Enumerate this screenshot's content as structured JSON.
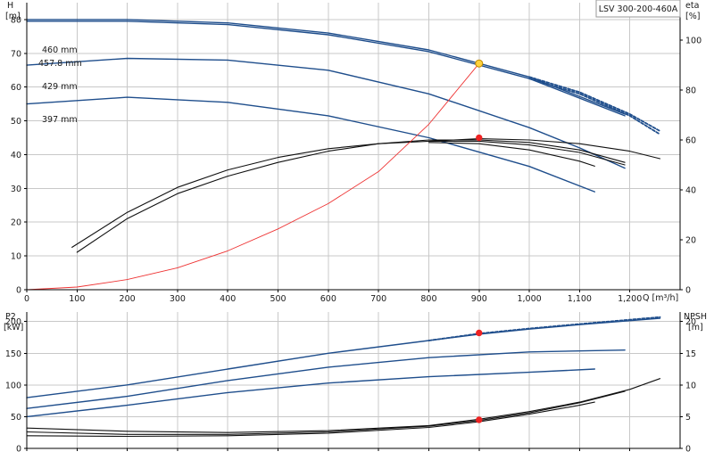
{
  "title": "LSV 300-200-460A",
  "colors": {
    "head": "#1f4e8c",
    "eff": "#111111",
    "system": "#ee3333",
    "duty": "#ee2222",
    "duty_highlight": "#ffd23c",
    "grid": "#c8c8c8"
  },
  "chart_data": [
    {
      "name": "head-chart",
      "type": "line",
      "title": "LSV 300-200-460A",
      "xlabel": "Q [m³/h]",
      "ylabel_left": "H [m]",
      "ylabel_right": "eta [%]",
      "xlim": [
        0,
        1300
      ],
      "ylim_left": [
        0,
        85
      ],
      "ylim_right": [
        0,
        115
      ],
      "x_ticks": [
        "0",
        "100",
        "200",
        "300",
        "400",
        "500",
        "600",
        "700",
        "800",
        "900",
        "1,000",
        "1,100",
        "1,200"
      ],
      "x_tick_values": [
        0,
        100,
        200,
        300,
        400,
        500,
        600,
        700,
        800,
        900,
        1000,
        1100,
        1200
      ],
      "y_ticks_left": [
        0,
        10,
        20,
        30,
        40,
        50,
        60,
        70,
        80
      ],
      "y_ticks_right": [
        0,
        20,
        40,
        60,
        80,
        100
      ],
      "grid": true,
      "diameter_labels": [
        "460 mm",
        "457.8 mm",
        "429 mm",
        "397 mm"
      ],
      "series": [
        {
          "name": "460 mm",
          "axis": "left",
          "style": "head",
          "x": [
            0,
            200,
            400,
            600,
            800,
            1000,
            1190
          ],
          "y": [
            80,
            80,
            79,
            76,
            71,
            63,
            52
          ]
        },
        {
          "axis": "left",
          "style": "head-dashed",
          "x": [
            1000,
            1100,
            1200,
            1260
          ],
          "y": [
            63,
            58.5,
            52,
            47
          ]
        },
        {
          "name": "457.8 mm",
          "axis": "left",
          "style": "head",
          "x": [
            0,
            200,
            400,
            600,
            800,
            1000,
            1190
          ],
          "y": [
            79.5,
            79.5,
            78.5,
            75.5,
            70.5,
            62.5,
            51.5
          ]
        },
        {
          "axis": "left",
          "style": "head-dashed",
          "x": [
            1000,
            1100,
            1200,
            1260
          ],
          "y": [
            62.5,
            58,
            51.5,
            46
          ]
        },
        {
          "name": "429 mm",
          "axis": "left",
          "style": "head",
          "x": [
            0,
            200,
            400,
            600,
            800,
            900,
            1000,
            1100,
            1190
          ],
          "y": [
            66.5,
            68.5,
            68,
            65,
            58,
            53,
            48,
            42,
            36
          ]
        },
        {
          "name": "397 mm",
          "axis": "left",
          "style": "head",
          "x": [
            0,
            200,
            400,
            600,
            800,
            1000,
            1130
          ],
          "y": [
            55,
            57,
            55.5,
            51.5,
            45,
            36.5,
            29
          ]
        },
        {
          "axis": "right",
          "style": "eff",
          "x": [
            90,
            200,
            300,
            400,
            500,
            600,
            700,
            800,
            900,
            1000,
            1100,
            1190
          ],
          "y": [
            17,
            31,
            41,
            48,
            53,
            56.5,
            58.5,
            60,
            60,
            59,
            56,
            51
          ]
        },
        {
          "axis": "right",
          "style": "eff",
          "x": [
            100,
            200,
            300,
            400,
            500,
            600,
            700,
            800,
            900,
            1000,
            1100,
            1200,
            1260
          ],
          "y": [
            15,
            28.5,
            38.5,
            45.5,
            51,
            55.5,
            58.5,
            59.5,
            60.5,
            60,
            58.5,
            55.5,
            52.5
          ]
        },
        {
          "axis": "right",
          "style": "eff",
          "x": [
            800,
            900,
            1000,
            1100,
            1190
          ],
          "y": [
            59.5,
            59.5,
            58,
            55,
            50
          ]
        },
        {
          "axis": "right",
          "style": "eff",
          "x": [
            800,
            900,
            1000,
            1100,
            1130
          ],
          "y": [
            59,
            58.5,
            56,
            51.5,
            49.5
          ]
        },
        {
          "axis": "left",
          "style": "system",
          "x": [
            0,
            100,
            200,
            300,
            400,
            500,
            600,
            700,
            800,
            900
          ],
          "y": [
            0,
            0.8,
            3,
            6.5,
            11.5,
            18,
            25.5,
            35,
            49,
            67
          ]
        }
      ],
      "duty_points": [
        {
          "x": 900,
          "y": 67,
          "axis": "left",
          "highlight": true
        },
        {
          "x": 900,
          "y": 45,
          "axis": "left"
        }
      ]
    },
    {
      "name": "power-npsh-chart",
      "type": "line",
      "ylabel_left": "P2 [kW]",
      "ylabel_right": "NPSH [m]",
      "xlim": [
        0,
        1300
      ],
      "ylim_left": [
        0,
        215
      ],
      "ylim_right": [
        0,
        21.5
      ],
      "y_ticks_left": [
        0,
        50,
        100,
        150,
        200
      ],
      "y_ticks_right": [
        0,
        5,
        10,
        15,
        20
      ],
      "grid": true,
      "series": [
        {
          "axis": "left",
          "style": "head",
          "x": [
            0,
            200,
            400,
            600,
            800,
            900,
            1000,
            1100,
            1260
          ],
          "y": [
            80,
            100,
            125,
            150,
            170,
            180,
            188,
            195,
            205
          ]
        },
        {
          "axis": "left",
          "style": "head-dashed",
          "x": [
            800,
            900,
            1000,
            1100,
            1260
          ],
          "y": [
            170,
            181,
            189,
            196,
            207
          ]
        },
        {
          "axis": "left",
          "style": "head",
          "x": [
            0,
            200,
            400,
            600,
            800,
            1000,
            1190
          ],
          "y": [
            63,
            82,
            107,
            128,
            143,
            152,
            155
          ]
        },
        {
          "axis": "left",
          "style": "head",
          "x": [
            0,
            200,
            400,
            600,
            800,
            1000,
            1130
          ],
          "y": [
            50,
            68,
            88,
            103,
            113,
            120,
            125
          ]
        },
        {
          "axis": "right",
          "style": "eff",
          "x": [
            0,
            200,
            400,
            600,
            800,
            900,
            1000,
            1100,
            1200,
            1260
          ],
          "y": [
            3.2,
            2.7,
            2.5,
            2.8,
            3.6,
            4.6,
            5.8,
            7.3,
            9.3,
            11
          ]
        },
        {
          "axis": "right",
          "style": "eff",
          "x": [
            0,
            200,
            400,
            600,
            800,
            900,
            1000,
            1100,
            1190
          ],
          "y": [
            2.6,
            2.2,
            2.2,
            2.6,
            3.5,
            4.4,
            5.6,
            7.2,
            9.0
          ]
        },
        {
          "axis": "right",
          "style": "eff",
          "x": [
            0,
            200,
            400,
            600,
            800,
            900,
            1000,
            1100,
            1130
          ],
          "y": [
            2.0,
            1.9,
            2.0,
            2.4,
            3.3,
            4.2,
            5.4,
            6.8,
            7.3
          ]
        }
      ],
      "duty_points": [
        {
          "x": 900,
          "y": 182,
          "axis": "left"
        },
        {
          "x": 900,
          "y": 4.5,
          "axis": "right"
        }
      ]
    }
  ]
}
